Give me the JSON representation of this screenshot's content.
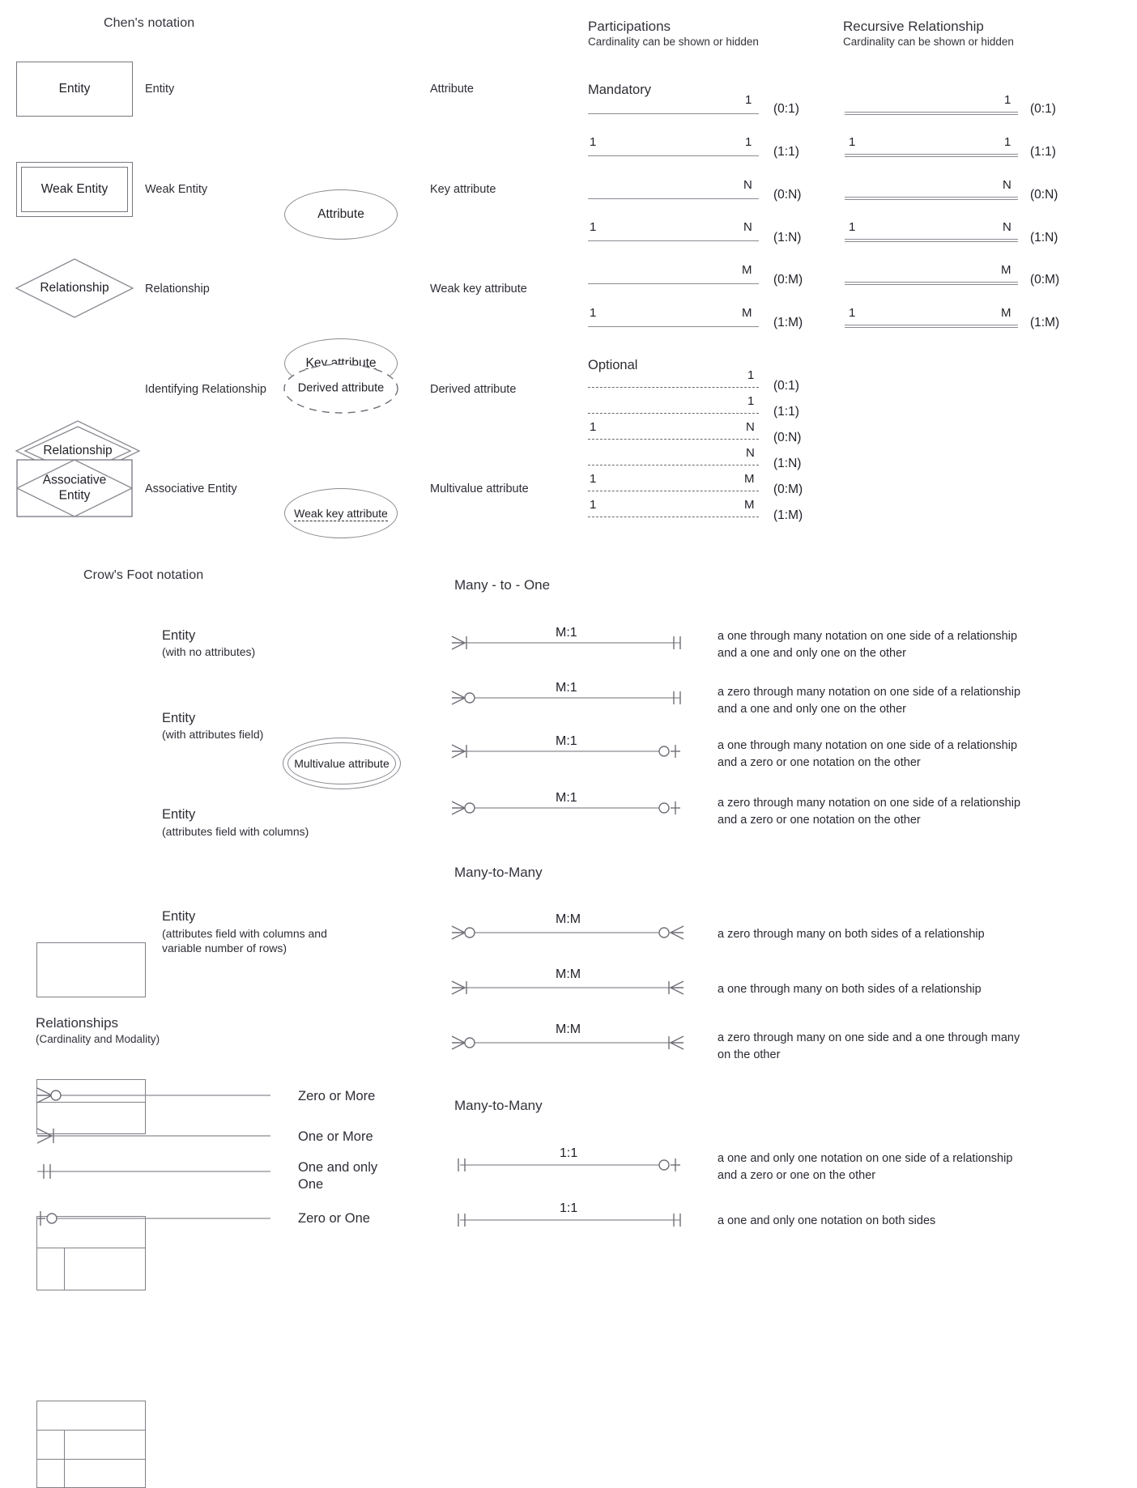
{
  "chen": {
    "title": "Chen's notation",
    "shapes_left": [
      {
        "shape_text": "Entity",
        "label": "Entity",
        "kind": "rect"
      },
      {
        "shape_text": "Weak Entity",
        "label": "Weak Entity",
        "kind": "double-rect"
      },
      {
        "shape_text": "Relationship",
        "label": "Relationship",
        "kind": "diamond"
      },
      {
        "shape_text": "Relationship",
        "label": "Identifying Relationship",
        "kind": "double-diamond"
      },
      {
        "shape_text": "Associative Entity",
        "label": "Associative Entity",
        "kind": "associative"
      }
    ],
    "shapes_right": [
      {
        "shape_text": "Attribute",
        "label": "Attribute",
        "kind": "ellipse"
      },
      {
        "shape_text": "Key attribute",
        "label": "Key attribute",
        "kind": "ellipse-underline"
      },
      {
        "shape_text": "Weak key attribute",
        "label": "Weak key attribute",
        "kind": "ellipse-dash-underline"
      },
      {
        "shape_text": "Derived attribute",
        "label": "Derived attribute",
        "kind": "ellipse-dashed"
      },
      {
        "shape_text": "Multivalue attribute",
        "label": "Multivalue attribute",
        "kind": "double-ellipse"
      }
    ],
    "associative_line1": "Associative",
    "associative_line2": "Entity"
  },
  "participations": {
    "title": "Participations",
    "subtitle": "Cardinality can be shown or hidden",
    "mandatory_label": "Mandatory",
    "optional_label": "Optional",
    "mandatory_rows": [
      {
        "left": "",
        "right": "1",
        "card": "(0:1)"
      },
      {
        "left": "1",
        "right": "1",
        "card": "(1:1)"
      },
      {
        "left": "",
        "right": "N",
        "card": "(0:N)"
      },
      {
        "left": "1",
        "right": "N",
        "card": "(1:N)"
      },
      {
        "left": "",
        "right": "M",
        "card": "(0:M)"
      },
      {
        "left": "1",
        "right": "M",
        "card": "(1:M)"
      }
    ],
    "optional_rows": [
      {
        "left": "",
        "right": "1",
        "card": "(0:1)"
      },
      {
        "left": "",
        "right": "1",
        "card": "(1:1)"
      },
      {
        "left": "1",
        "right": "N",
        "card": "(0:N)"
      },
      {
        "left": "",
        "right": "N",
        "card": "(1:N)"
      },
      {
        "left": "1",
        "right": "M",
        "card": "(0:M)"
      },
      {
        "left": "1",
        "right": "M",
        "card": "(1:M)"
      }
    ]
  },
  "recursive": {
    "title": "Recursive Relationship",
    "subtitle": "Cardinality can be shown or hidden",
    "rows": [
      {
        "left": "",
        "right": "1",
        "card": "(0:1)"
      },
      {
        "left": "1",
        "right": "1",
        "card": "(1:1)"
      },
      {
        "left": "",
        "right": "N",
        "card": "(0:N)"
      },
      {
        "left": "1",
        "right": "N",
        "card": "(1:N)"
      },
      {
        "left": "",
        "right": "M",
        "card": "(0:M)"
      },
      {
        "left": "1",
        "right": "M",
        "card": "(1:M)"
      }
    ]
  },
  "crowsfoot": {
    "title": "Crow's Foot notation",
    "entities": [
      {
        "name": "Entity",
        "sub": "(with no attributes)"
      },
      {
        "name": "Entity",
        "sub": "(with attributes field)"
      },
      {
        "name": "Entity",
        "sub": "(attributes field with columns)"
      },
      {
        "name": "Entity",
        "sub": "(attributes field with columns and\nvariable number of rows)"
      }
    ],
    "relationships_title": "Relationships",
    "relationships_sub": "(Cardinality and Modality)",
    "symbols": [
      {
        "label": "Zero or More",
        "end": "crow-circle"
      },
      {
        "label": "One or More",
        "end": "crow-tick"
      },
      {
        "label": "One and only\nOne",
        "end": "double-tick"
      },
      {
        "label": "Zero or One",
        "end": "tick-circle"
      }
    ]
  },
  "many_to_one": {
    "title": "Many - to - One",
    "rows": [
      {
        "mid": "M:1",
        "left_end": "crow-tick",
        "right_end": "double-tick",
        "desc": "a one through many notation on one side of a relationship\nand a one and only one on the other"
      },
      {
        "mid": "M:1",
        "left_end": "crow-circle",
        "right_end": "double-tick",
        "desc": "a zero through many notation on one side of a relationship\nand a one and only one on the other"
      },
      {
        "mid": "M:1",
        "left_end": "crow-tick",
        "right_end": "circle-tick",
        "desc": "a one through many notation on one side of a relationship\nand a zero or one notation on the other"
      },
      {
        "mid": "M:1",
        "left_end": "crow-circle",
        "right_end": "circle-tick",
        "desc": "a zero through many notation on one side of a relationship\nand a zero or one notation on the other"
      }
    ]
  },
  "many_to_many": {
    "title": "Many-to-Many",
    "rows": [
      {
        "mid": "M:M",
        "left_end": "crow-circle",
        "right_end": "circle-crow",
        "desc": "a zero through many on both sides of a relationship"
      },
      {
        "mid": "M:M",
        "left_end": "crow-tick",
        "right_end": "tick-crow",
        "desc": "a one through many on both sides of a relationship"
      },
      {
        "mid": "M:M",
        "left_end": "crow-circle",
        "right_end": "tick-crow",
        "desc": "a zero through many on one side and a one through many\non the other"
      }
    ]
  },
  "one_to_one": {
    "title": "Many-to-Many",
    "rows": [
      {
        "mid": "1:1",
        "left_end": "double-tick",
        "right_end": "circle-tick",
        "desc": "a one and only one notation on one side of a relationship\nand a zero or one on the other"
      },
      {
        "mid": "1:1",
        "left_end": "double-tick",
        "right_end": "double-tick",
        "desc": "a one and only one notation on both sides"
      }
    ]
  },
  "colors": {
    "line": "#8a8a92",
    "shape_stroke": "#77777f",
    "text": "#2a2a33"
  }
}
